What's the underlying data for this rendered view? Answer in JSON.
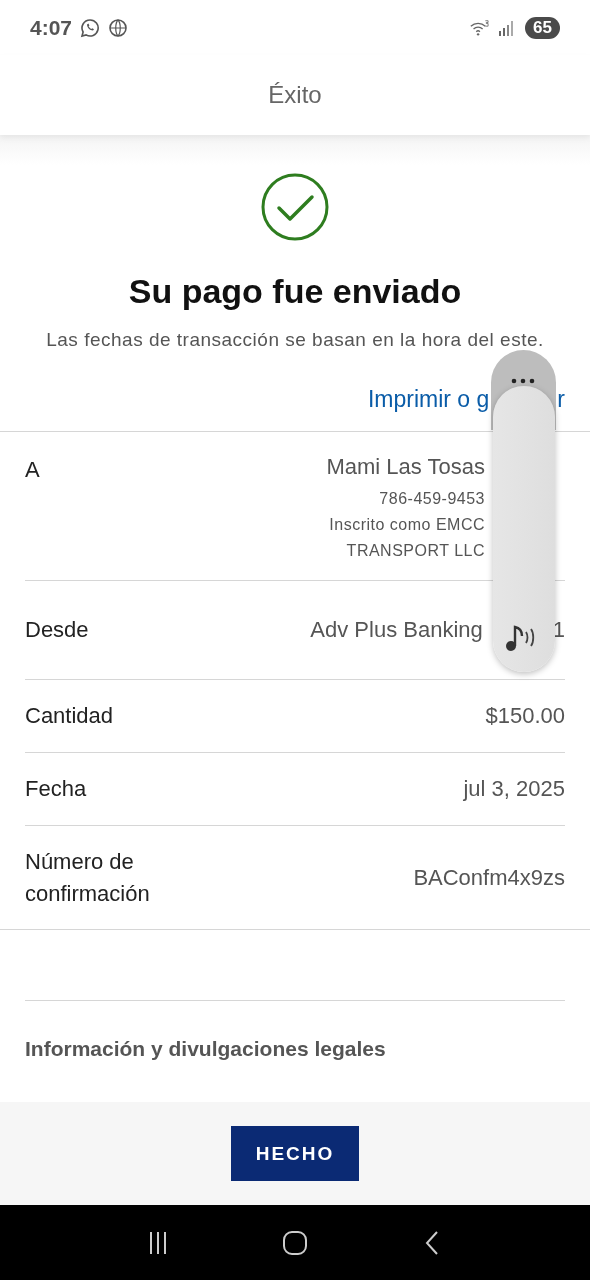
{
  "status_bar": {
    "time": "4:07",
    "battery": "65"
  },
  "header": {
    "title": "Éxito"
  },
  "confirmation": {
    "title": "Su pago fue enviado",
    "note": "Las fechas de transacción se basan en la hora del este.",
    "print_link_parts": [
      "Imprimir o g",
      "r"
    ]
  },
  "details": [
    {
      "kind": "payee",
      "label": "A",
      "name": "Mami Las Tosas",
      "lines": [
        "786-459-9453",
        "Inscrito como EMCC",
        "TRANSPORT LLC"
      ]
    },
    {
      "kind": "split",
      "label": "Desde",
      "parts": [
        "Adv Plus Banking",
        "1"
      ]
    },
    {
      "kind": "plain",
      "label": "Cantidad",
      "value": "$150.00"
    },
    {
      "kind": "plain",
      "label": "Fecha",
      "value": "jul 3, 2025"
    },
    {
      "kind": "plain",
      "label": "Número de confirmación",
      "value": "BAConfm4x9zs"
    }
  ],
  "legal": {
    "title": "Información y divulgaciones legales"
  },
  "footer": {
    "button": "HECHO"
  }
}
